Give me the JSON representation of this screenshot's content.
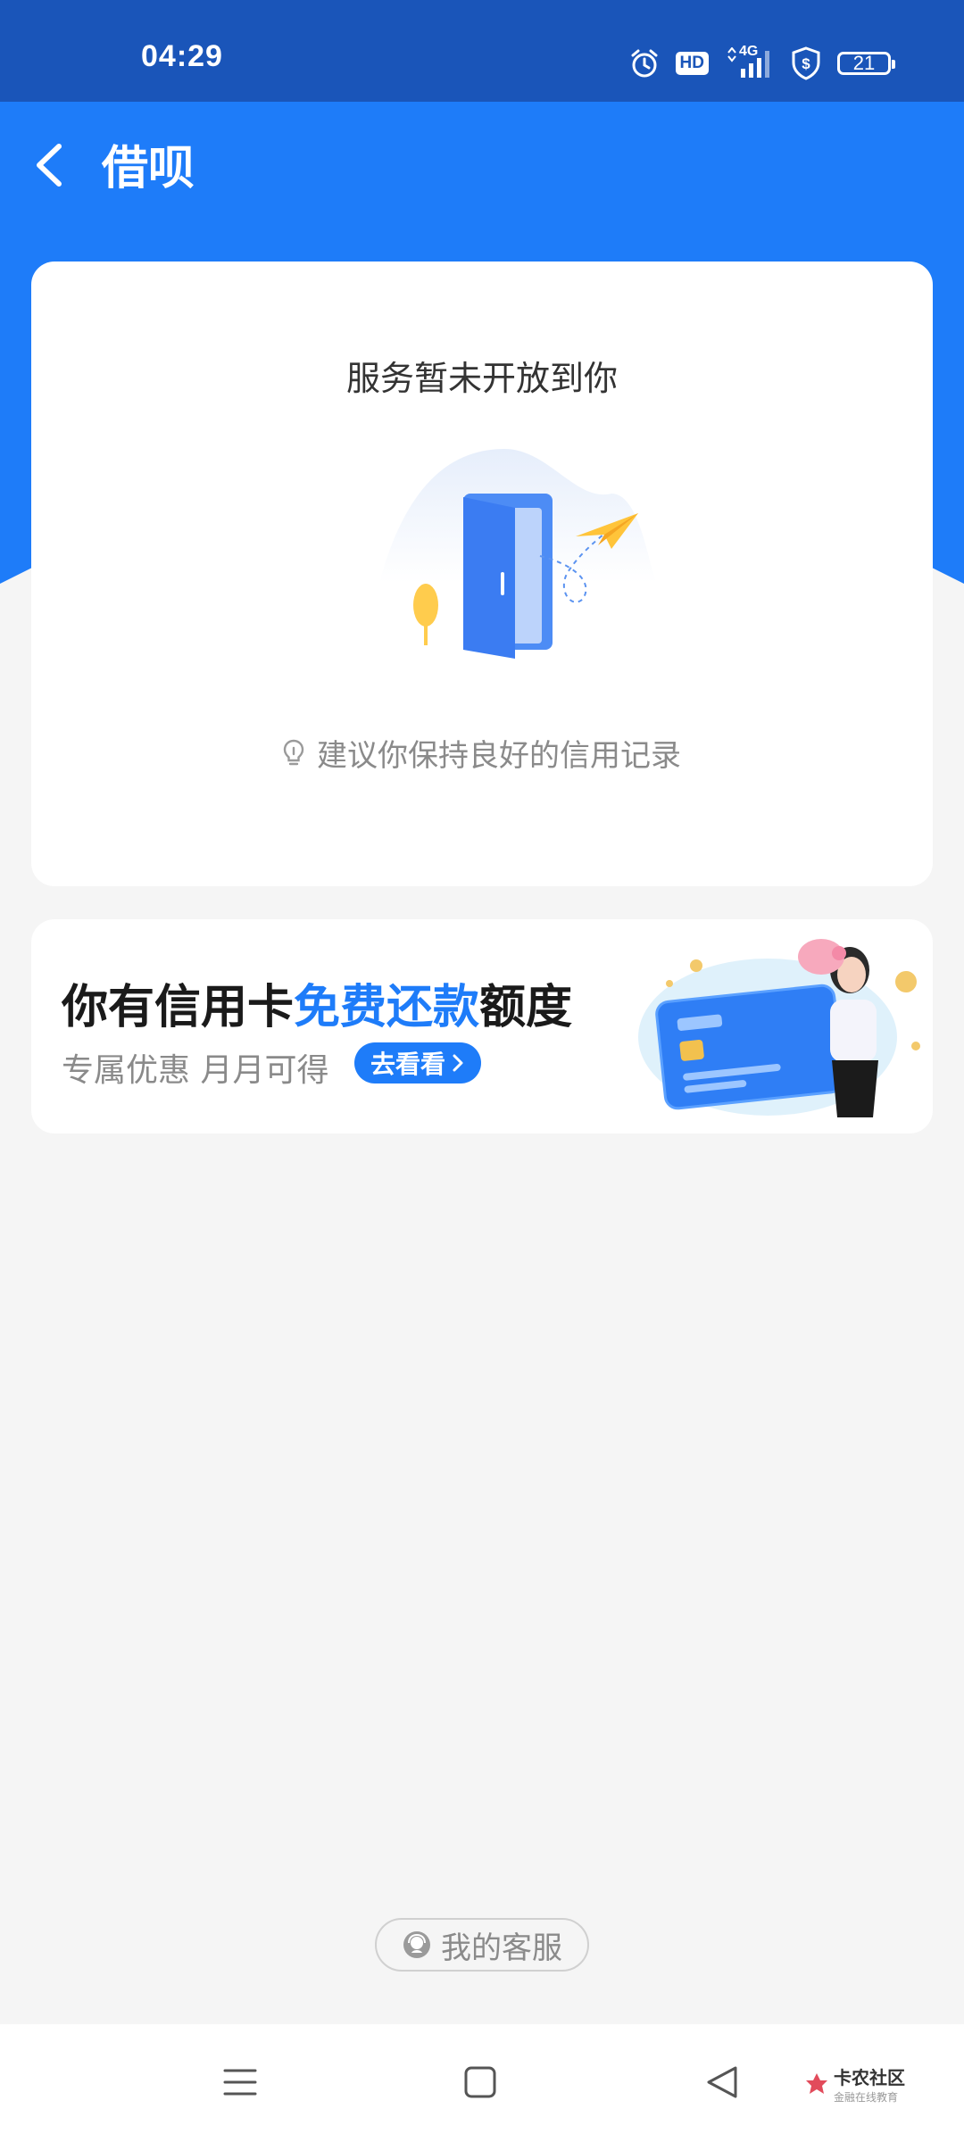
{
  "status_bar": {
    "time": "04:29",
    "hd_label": "HD",
    "network_label": "4G",
    "battery_level": "21",
    "icons": [
      "alarm-icon",
      "hd-icon",
      "signal-icon",
      "shield-dollar-icon",
      "battery-icon"
    ]
  },
  "header": {
    "title": "借呗",
    "back_icon": "chevron-left-icon"
  },
  "main_card": {
    "title": "服务暂未开放到你",
    "hint": "建议你保持良好的信用记录",
    "hint_icon": "lightbulb-icon"
  },
  "promo": {
    "title_prefix": "你有信用卡",
    "title_highlight": "免费还款",
    "title_suffix": "额度",
    "subtitle": "专属优惠 月月可得",
    "button_label": "去看看"
  },
  "customer_service": {
    "label": "我的客服",
    "icon": "headset-avatar-icon"
  },
  "system_nav": {
    "icons": [
      "menu-icon",
      "home-square-icon",
      "back-triangle-icon"
    ]
  },
  "watermark": {
    "text_main": "卡农社区",
    "text_sub": "金融在线教育"
  },
  "colors": {
    "primary": "#1e7cf9",
    "status_bar": "#1a55b9",
    "background": "#f5f5f5"
  }
}
